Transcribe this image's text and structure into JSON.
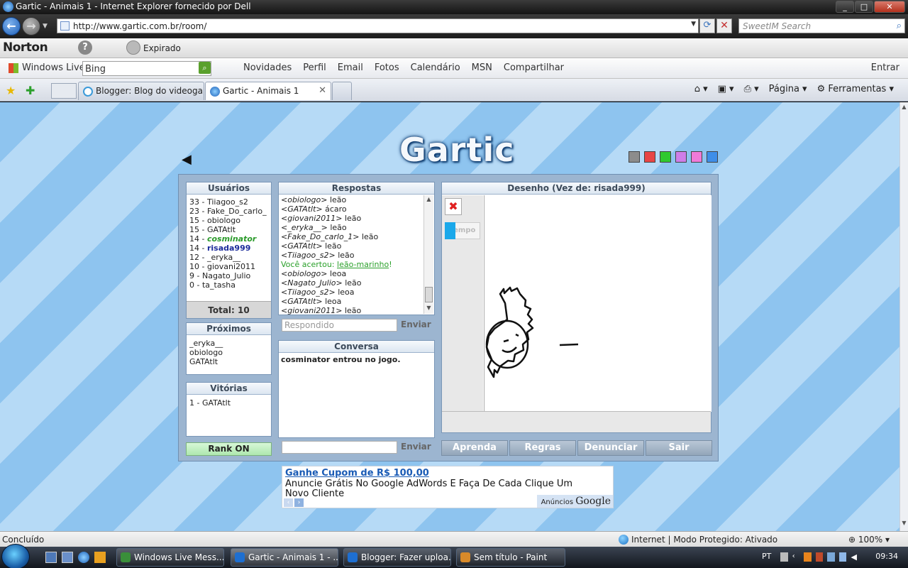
{
  "window": {
    "title": "Gartic - Animais 1 - Internet Explorer fornecido por Dell"
  },
  "address": {
    "url": "http://www.gartic.com.br/room/",
    "search_placeholder": "SweetIM Search"
  },
  "norton": {
    "brand": "Norton",
    "status": "Expirado"
  },
  "windows_live": {
    "brand": "Windows Live",
    "search_value": "Bing",
    "links": [
      "Novidades",
      "Perfil",
      "Email",
      "Fotos",
      "Calendário",
      "MSN",
      "Compartilhar"
    ],
    "signin": "Entrar"
  },
  "tabs": [
    {
      "label": "Blogger: Blog do videoga..."
    },
    {
      "label": "Gartic - Animais 1"
    }
  ],
  "commands": {
    "page": "Página",
    "tools": "Ferramentas"
  },
  "game": {
    "logo": "Gartic",
    "colors": [
      "#8c8c8c",
      "#e84545",
      "#2fc92f",
      "#cf7ee8",
      "#f07ad8",
      "#3e8ee8"
    ],
    "users_header": "Usuários",
    "users": [
      {
        "score": "33",
        "name": "Tiiagoo_s2",
        "style": ""
      },
      {
        "score": "23",
        "name": "Fake_Do_carlo_",
        "style": ""
      },
      {
        "score": "15",
        "name": "obiologo",
        "style": ""
      },
      {
        "score": "15",
        "name": "GATAtlt",
        "style": ""
      },
      {
        "score": "14",
        "name": "cosminator",
        "style": "me"
      },
      {
        "score": "14",
        "name": "risada999",
        "style": "drawer"
      },
      {
        "score": "12",
        "name": "_eryka__",
        "style": ""
      },
      {
        "score": "10",
        "name": "giovani2011",
        "style": ""
      },
      {
        "score": "9",
        "name": "Nagato_Julio",
        "style": ""
      },
      {
        "score": "0",
        "name": "ta_tasha",
        "style": ""
      }
    ],
    "users_total": "Total: 10",
    "next_header": "Próximos",
    "next": [
      "_eryka__",
      "obiologo",
      "GATAtlt"
    ],
    "wins_header": "Vitórias",
    "wins": [
      "1 - GATAtlt"
    ],
    "rank_button": "Rank ON",
    "answers_header": "Respostas",
    "answers": [
      {
        "user": "obiologo",
        "text": "leão"
      },
      {
        "user": "GATAtlt",
        "text": "ácaro"
      },
      {
        "user": "giovani2011",
        "text": "leão"
      },
      {
        "user": "_eryka__",
        "text": "leão"
      },
      {
        "user": "Fake_Do_carlo_1",
        "text": "leão"
      },
      {
        "user": "GATAtlt",
        "text": "leão"
      },
      {
        "user": "Tiiagoo_s2",
        "text": "leão"
      },
      {
        "user": "",
        "text": "Você acertou: ",
        "word": "leão-marinho",
        "suffix": "!"
      },
      {
        "user": "obiologo",
        "text": "leoa"
      },
      {
        "user": "Nagato_Julio",
        "text": "leão"
      },
      {
        "user": "Tiiagoo_s2",
        "text": "leoa"
      },
      {
        "user": "GATAtlt",
        "text": "leoa"
      },
      {
        "user": "giovani2011",
        "text": "leão"
      }
    ],
    "answer_placeholder": "Respondido",
    "send_label": "Enviar",
    "chat_header": "Conversa",
    "chat_messages": [
      "cosminator entrou no jogo."
    ],
    "chat_send_label": "Enviar",
    "drawing_header": "Desenho (Vez de: risada999)",
    "timer_label": "Tempo",
    "timer_fraction": 0.3,
    "actions": [
      "Aprenda",
      "Regras",
      "Denunciar",
      "Sair"
    ]
  },
  "ad": {
    "title": "Ganhe Cupom de R$ 100,00",
    "body": "Anuncie Grátis No Google AdWords E Faça De Cada Clique Um Novo Cliente",
    "label_small": "Anúncios",
    "label_brand": "Google"
  },
  "status": {
    "text": "Concluído",
    "zone": "Internet | Modo Protegido: Ativado",
    "zoom": "100%"
  },
  "taskbar": {
    "tasks": [
      {
        "label": "Windows Live Mess...",
        "color": "#3a8f3a"
      },
      {
        "label": "Gartic - Animais 1 - ...",
        "color": "#1e6fd1"
      },
      {
        "label": "Blogger: Fazer uploa...",
        "color": "#1e6fd1"
      },
      {
        "label": "Sem título - Paint",
        "color": "#d88a2a"
      }
    ],
    "lang": "PT",
    "time": "09:34"
  }
}
